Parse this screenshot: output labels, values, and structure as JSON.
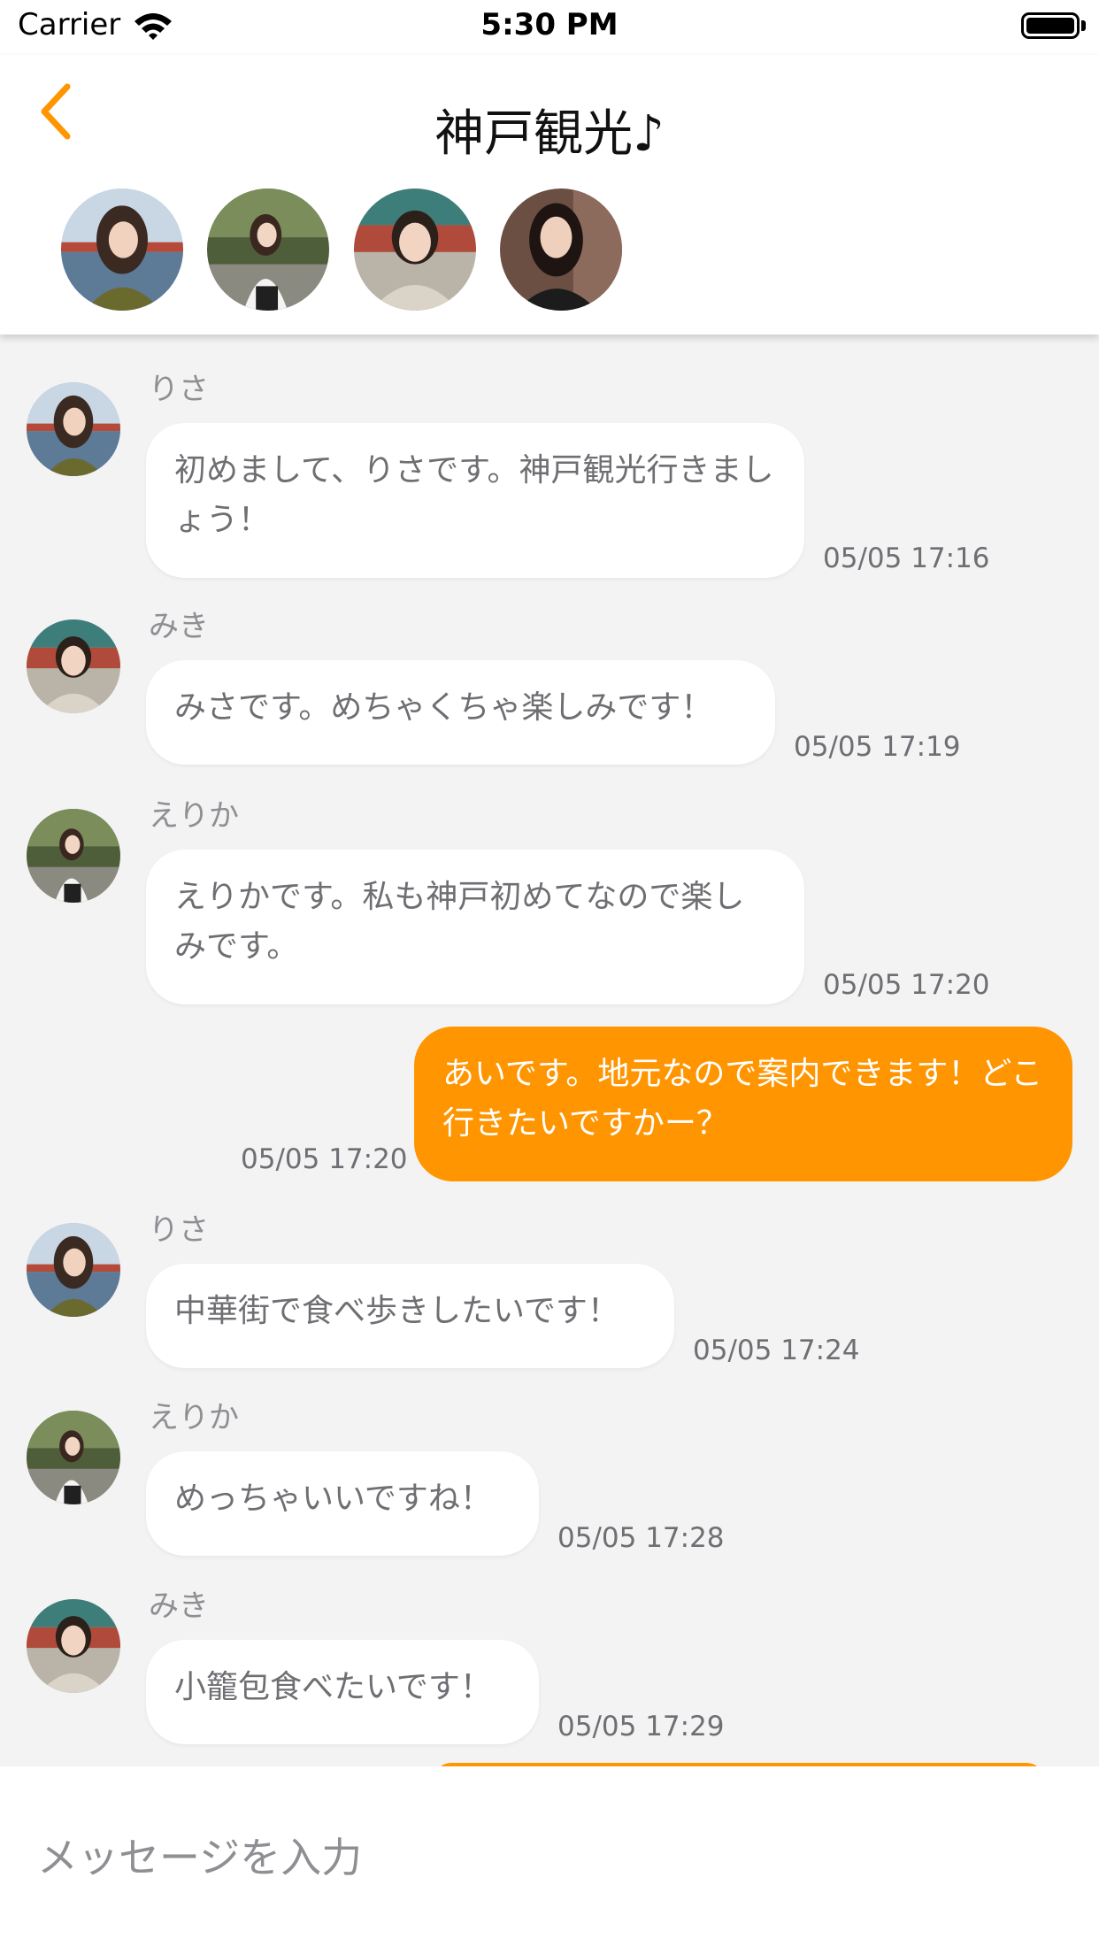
{
  "status_bar": {
    "carrier": "Carrier",
    "time": "5:30 PM"
  },
  "header": {
    "title": "神戸観光♪",
    "members": [
      "risa",
      "erika",
      "miki",
      "ai"
    ]
  },
  "colors": {
    "accent": "#ff9500",
    "background": "#f3f3f4",
    "incoming_bubble": "#ffffff"
  },
  "messages": [
    {
      "sender": "りさ",
      "text": "初めまして、りさです。神戸観光行きましょう！",
      "time": "05/05 17:16",
      "outgoing": false
    },
    {
      "sender": "みき",
      "text": "みさです。めちゃくちゃ楽しみです！",
      "time": "05/05 17:19",
      "outgoing": false
    },
    {
      "sender": "えりか",
      "text": "えりかです。私も神戸初めてなので楽しみです。",
      "time": "05/05 17:20",
      "outgoing": false
    },
    {
      "sender": "",
      "text": "あいです。地元なので案内できます！どこ行きたいですかー？",
      "time": "05/05 17:20",
      "outgoing": true
    },
    {
      "sender": "りさ",
      "text": "中華街で食べ歩きしたいです！",
      "time": "05/05 17:24",
      "outgoing": false
    },
    {
      "sender": "えりか",
      "text": "めっちゃいいですね！",
      "time": "05/05 17:28",
      "outgoing": false
    },
    {
      "sender": "みき",
      "text": "小籠包食べたいです！",
      "time": "05/05 17:29",
      "outgoing": false
    }
  ],
  "input": {
    "placeholder": "メッセージを入力"
  }
}
